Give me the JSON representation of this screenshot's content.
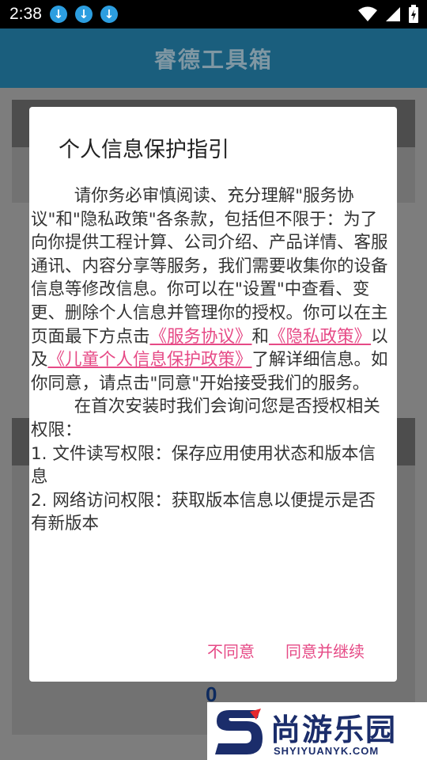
{
  "status_bar": {
    "time": "2:38",
    "download_icons": [
      "download-icon",
      "download-icon",
      "download-icon"
    ]
  },
  "app_bar": {
    "title": "睿德工具箱"
  },
  "background": {
    "value": "0"
  },
  "dialog": {
    "title": "个人信息保护指引",
    "para1_a": "        请你务必审慎阅读、充分理解\"服务协议\"和\"隐私政策\"各条款，包括但不限于：为了向你提供工程计算、公司介绍、产品详情、客服通讯、内容分享等服务，我们需要收集你的设备信息等修改信息。你可以在\"设置\"中查看、变更、删除个人信息并管理你的授权。你可以在主页面最下方点击",
    "link_service": "《服务协议》",
    "and": "和",
    "link_privacy": "《隐私政策》",
    "yiji": "以及",
    "link_child": "《儿童个人信息保护政策》",
    "para1_b": "了解详细信息。如你同意，请点击\"同意\"开始接受我们的服务。",
    "para2": "        在首次安装时我们会询问您是否授权相关权限：\n1. 文件读写权限：保存应用使用状态和版本信息\n2. 网络访问权限：获取版本信息以便提示是否有新版本",
    "disagree_label": "不同意",
    "agree_label": "同意并继续"
  },
  "watermark": {
    "brand": "尚游乐园",
    "url": "SHYIYUANYK.COM"
  },
  "colors": {
    "accent": "#e64a86",
    "app_bar": "#1a5e7d",
    "download_badge": "#2c9ee0"
  }
}
